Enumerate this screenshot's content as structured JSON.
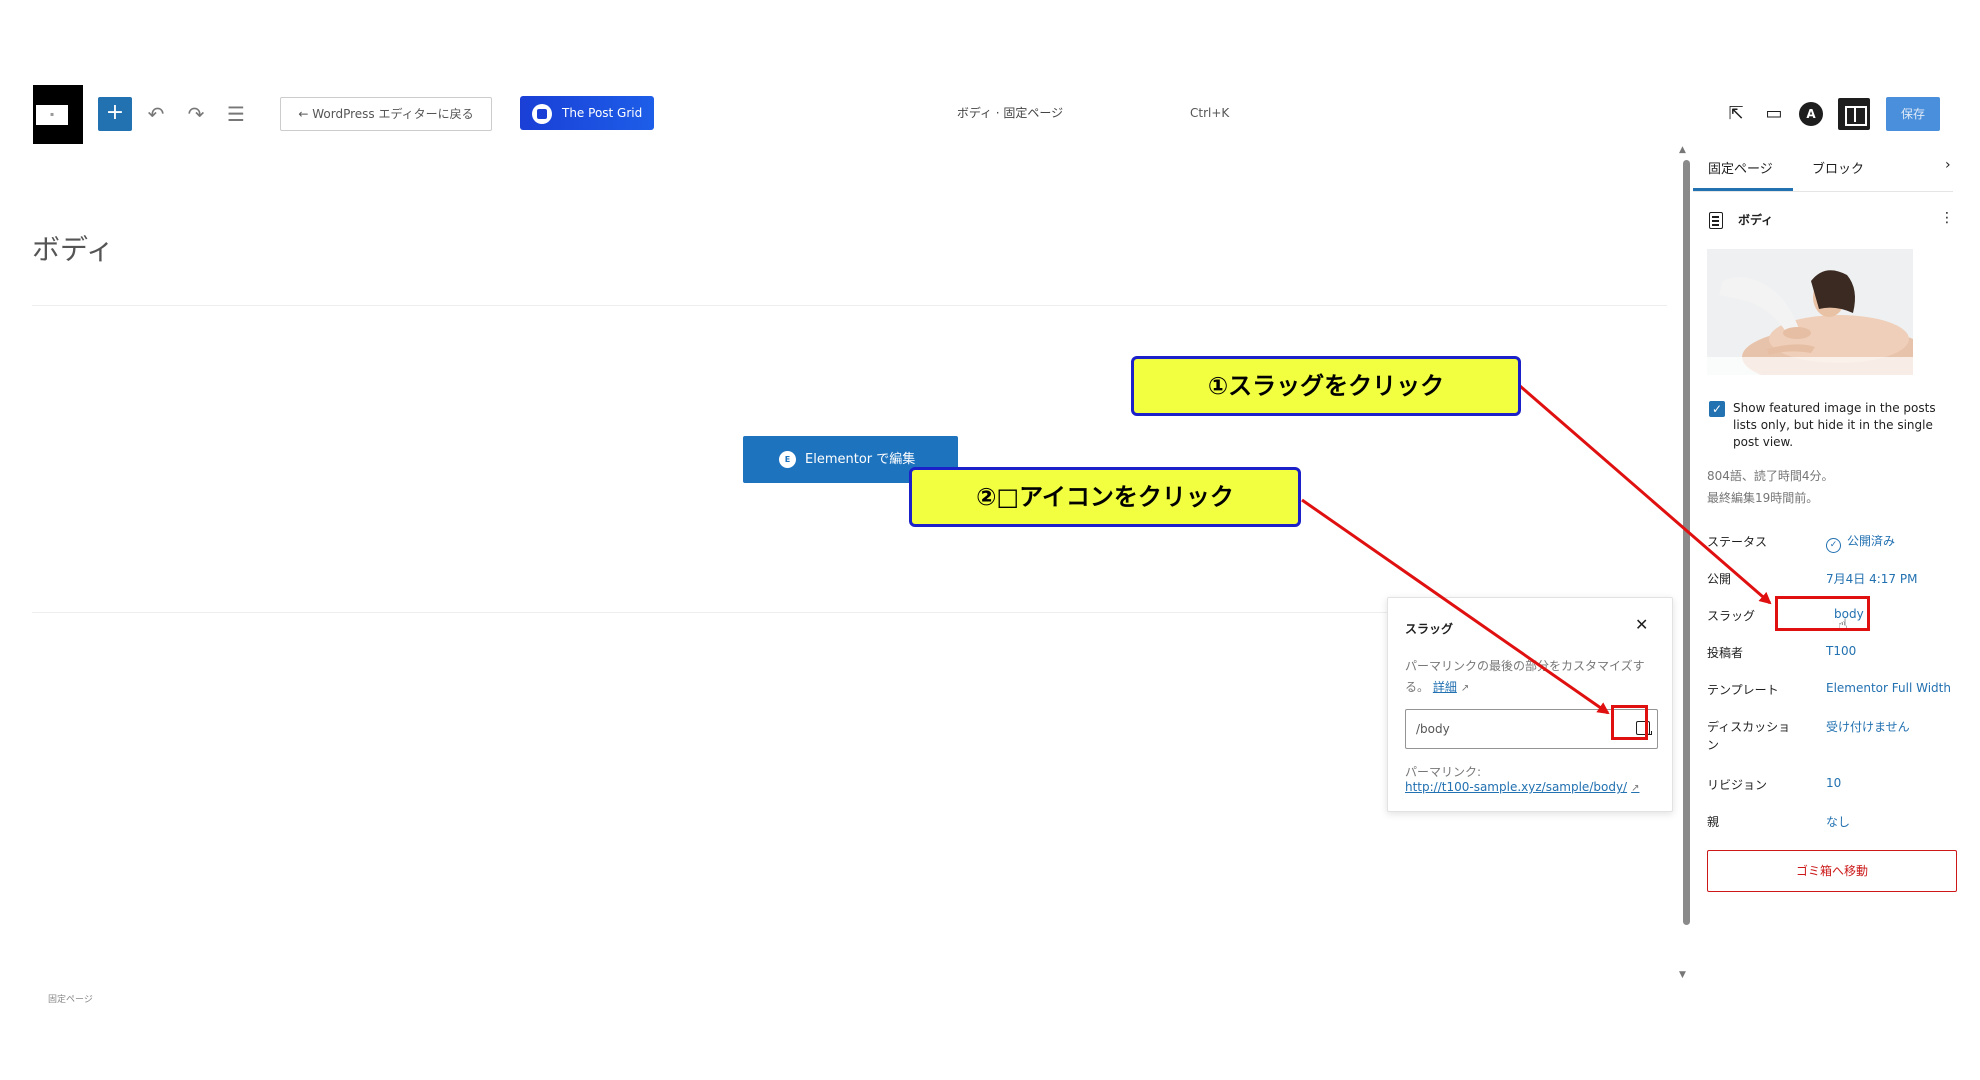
{
  "toolbar": {
    "back_label": "← WordPress エディターに戻る",
    "post_grid_label": "The Post Grid",
    "doc_title": "ボディ · 固定ページ",
    "shortcut": "Ctrl+K",
    "save_label": "保存"
  },
  "editor": {
    "page_title": "ボディ",
    "elementor_label": "Elementor で編集",
    "footer_crumb": "固定ページ"
  },
  "slug_popover": {
    "title": "スラッグ",
    "help_text": "パーマリンクの最後の部分をカスタマイズする。",
    "help_link": "詳細",
    "slug_value": "/body",
    "permalink_label": "パーマリンク:",
    "permalink_url": "http://t100-sample.xyz/sample/body/"
  },
  "sidebar": {
    "tabs": [
      {
        "label": "固定ページ",
        "active": true
      },
      {
        "label": "ブロック",
        "active": false
      }
    ],
    "doc_title": "ボディ",
    "featured_checkbox_checked": true,
    "featured_checkbox_label": "Show featured image in the posts lists only, but hide it in the single post view.",
    "word_count": "804語、読了時間4分。",
    "last_edited": "最終編集19時間前。",
    "rows": [
      {
        "label": "ステータス",
        "value": "公開済み"
      },
      {
        "label": "公開",
        "value": "7月4日 4:17 PM"
      },
      {
        "label": "スラッグ",
        "value": "body"
      },
      {
        "label": "投稿者",
        "value": "T100"
      },
      {
        "label": "テンプレート",
        "value": "Elementor Full Width"
      },
      {
        "label": "ディスカッション",
        "value": "受け付けません"
      },
      {
        "label": "リビジョン",
        "value": "10"
      },
      {
        "label": "親",
        "value": "なし"
      }
    ],
    "trash_label": "ゴミ箱へ移動"
  },
  "annotations": {
    "step1": "①スラッグをクリック",
    "step2": "②□アイコンをクリック",
    "color_fill": "#f1ff40",
    "color_border": "#1b20c8",
    "color_arrow": "#e01010"
  },
  "colors": {
    "accent": "#2271b1",
    "elementor": "#1e73be",
    "danger": "#cc1818"
  }
}
